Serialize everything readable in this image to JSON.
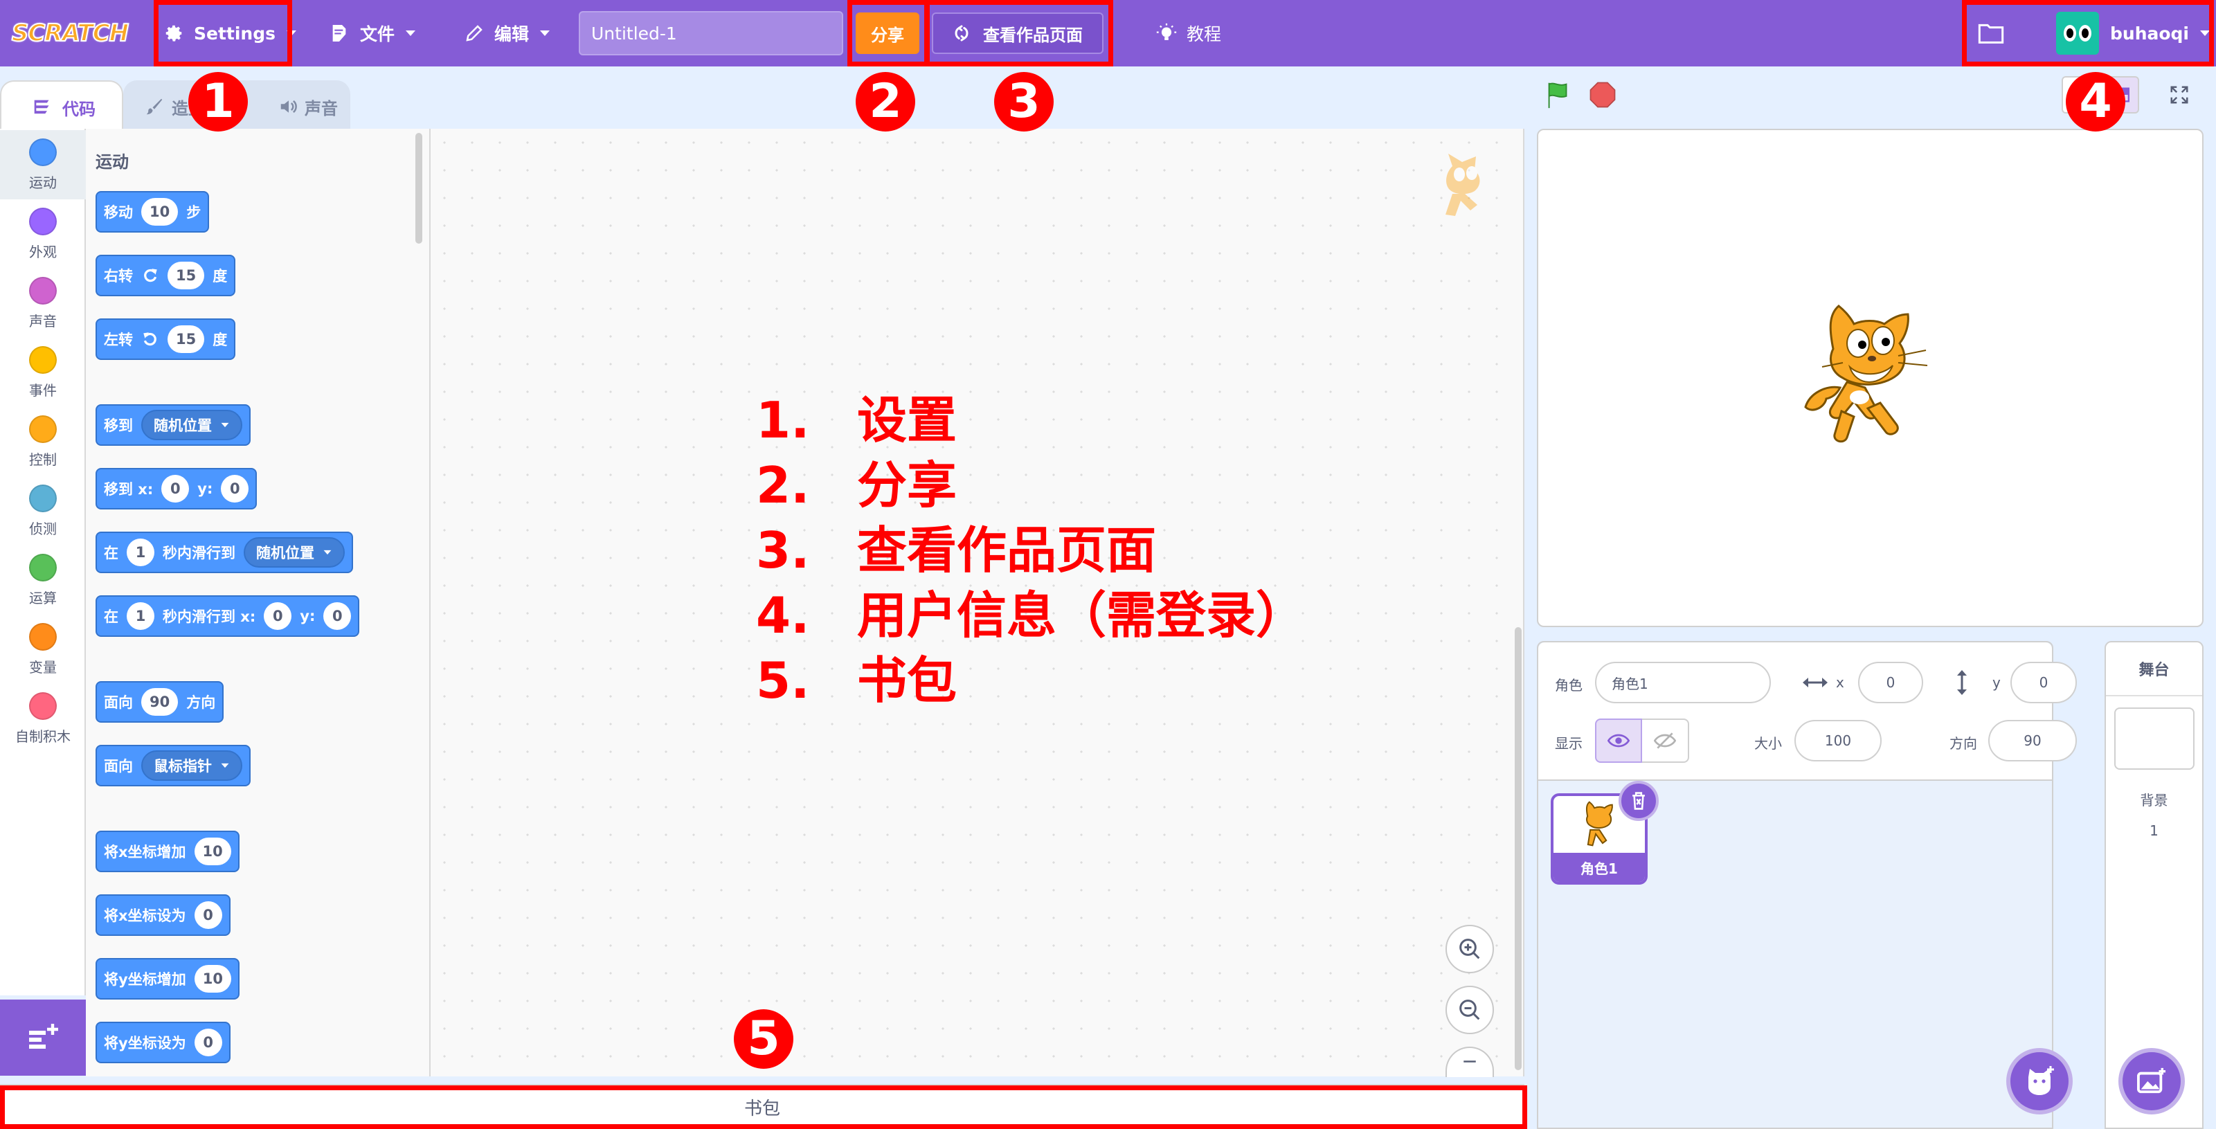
{
  "menubar": {
    "logo": "SCRATCH",
    "settings_label": "Settings",
    "file_label": "文件",
    "edit_label": "编辑",
    "project_title": "Untitled-1",
    "share_label": "分享",
    "project_page_label": "查看作品页面",
    "tutorials_label": "教程",
    "username": "buhaoqi",
    "bg_color": "#855cd6"
  },
  "tabs": {
    "code": "代码",
    "costumes": "造型",
    "sounds": "声音"
  },
  "categories": [
    {
      "label": "运动",
      "color": "#4c97ff"
    },
    {
      "label": "外观",
      "color": "#9966ff"
    },
    {
      "label": "声音",
      "color": "#cf63cf"
    },
    {
      "label": "事件",
      "color": "#ffbf00"
    },
    {
      "label": "控制",
      "color": "#ffab19"
    },
    {
      "label": "侦测",
      "color": "#5cb1d6"
    },
    {
      "label": "运算",
      "color": "#59c059"
    },
    {
      "label": "变量",
      "color": "#ff8c1a"
    },
    {
      "label": "自制积木",
      "color": "#ff6680"
    }
  ],
  "palette": {
    "heading": "运动",
    "move": {
      "text": "移动",
      "value": "10",
      "unit": "步"
    },
    "turn_right": {
      "text": "右转",
      "value": "15",
      "unit": "度"
    },
    "turn_left": {
      "text": "左转",
      "value": "15",
      "unit": "度"
    },
    "goto": {
      "text": "移到",
      "menu": "随机位置"
    },
    "goto_xy": {
      "text": "移到 x:",
      "x": "0",
      "ylabel": "y:",
      "y": "0"
    },
    "glide": {
      "text": "在",
      "secs": "1",
      "mid": "秒内滑行到",
      "menu": "随机位置"
    },
    "glide_xy": {
      "text": "在",
      "secs": "1",
      "mid": "秒内滑行到 x:",
      "x": "0",
      "ylabel": "y:",
      "y": "0"
    },
    "point_dir": {
      "text": "面向",
      "value": "90",
      "unit": "方向"
    },
    "point_towards": {
      "text": "面向",
      "menu": "鼠标指针"
    },
    "change_x": {
      "text": "将x坐标增加",
      "value": "10"
    },
    "set_x": {
      "text": "将x坐标设为",
      "value": "0"
    },
    "change_y": {
      "text": "将y坐标增加",
      "value": "10"
    },
    "set_y": {
      "text": "将y坐标设为",
      "value": "0"
    }
  },
  "annotations": {
    "callouts": [
      "1",
      "2",
      "3",
      "4",
      "5"
    ],
    "list": [
      {
        "num": "1.",
        "text": "设置"
      },
      {
        "num": "2.",
        "text": "分享"
      },
      {
        "num": "3.",
        "text": "查看作品页面"
      },
      {
        "num": "4.",
        "text": "用户信息（需登录）"
      },
      {
        "num": "5.",
        "text": "书包"
      }
    ],
    "color": "#ff0000"
  },
  "backpack": {
    "label": "书包"
  },
  "sprite_info": {
    "sprite_label": "角色",
    "sprite_name": "角色1",
    "x_label": "x",
    "x_value": "0",
    "y_label": "y",
    "y_value": "0",
    "show_label": "显示",
    "size_label": "大小",
    "size_value": "100",
    "direction_label": "方向",
    "direction_value": "90"
  },
  "sprites": [
    {
      "name": "角色1"
    }
  ],
  "stage_panel": {
    "title": "舞台",
    "backdrops_label": "背景",
    "backdrops_count": "1"
  }
}
